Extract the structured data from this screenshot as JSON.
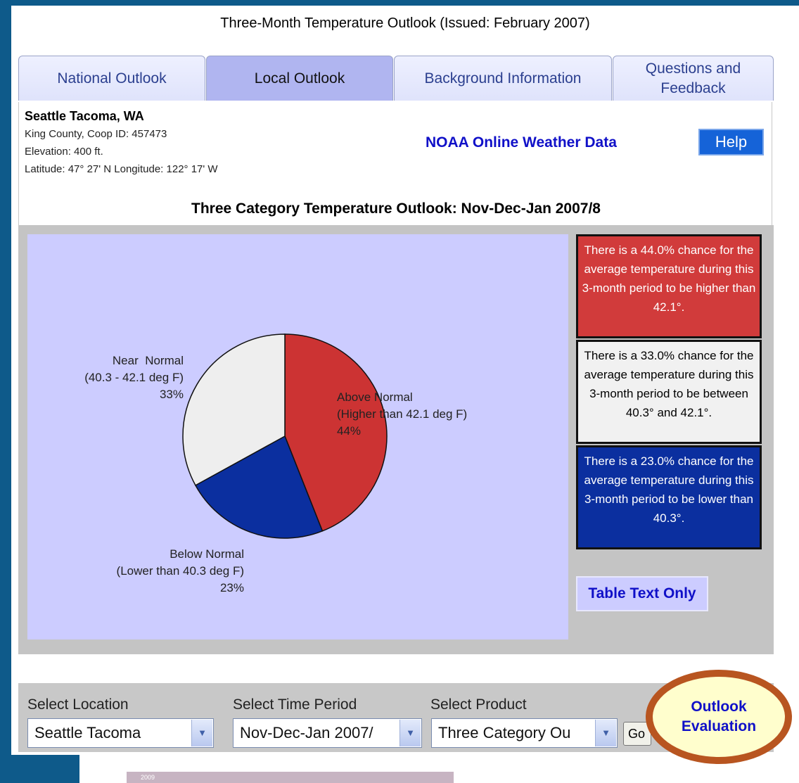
{
  "page_title": "Three-Month Temperature Outlook (Issued: February 2007)",
  "tabs": [
    {
      "label": "National Outlook",
      "active": false
    },
    {
      "label": "Local Outlook",
      "active": true
    },
    {
      "label": "Background Information",
      "active": false
    },
    {
      "label": "Questions and Feedback",
      "active": false
    }
  ],
  "location": {
    "name": "Seattle Tacoma, WA",
    "county": "King County, Coop ID: 457473",
    "elevation": "Elevation: 400 ft.",
    "latlon": "Latitude: 47° 27' N Longitude: 122° 17' W"
  },
  "noaa_link": "NOAA Online Weather Data",
  "help_label": "Help",
  "chart_title": "Three Category Temperature Outlook: Nov-Dec-Jan 2007/8",
  "chart_data": {
    "type": "pie",
    "title": "Three Category Temperature Outlook: Nov-Dec-Jan 2007/8",
    "slices": [
      {
        "label": "Above Normal",
        "detail": "(Higher than 42.1 deg F)",
        "value": 44,
        "pct_label": "44%",
        "color": "#cc3333"
      },
      {
        "label": "Below Normal",
        "detail": "(Lower than 40.3 deg F)",
        "value": 23,
        "pct_label": "23%",
        "color": "#0b2f9f"
      },
      {
        "label": "Near  Normal",
        "detail": "(40.3 - 42.1 deg F)",
        "value": 33,
        "pct_label": "33%",
        "color": "#eeeeee"
      }
    ]
  },
  "prob_boxes": {
    "above": "There is a 44.0% chance for the average temperature during this 3-month period to be higher than 42.1°.",
    "near": "There is a 33.0% chance for the average temperature during this 3-month period to be between 40.3° and 42.1°.",
    "below": "There is a 23.0% chance for the average temperature during this 3-month period to be lower than 40.3°."
  },
  "table_text_only": "Table Text Only",
  "controls": {
    "location_label": "Select Location",
    "location_value": "Seattle Tacoma",
    "period_label": "Select Time Period",
    "period_value": "Nov-Dec-Jan 2007/",
    "product_label": "Select Product",
    "product_value": "Three Category Ou",
    "go_label": "Go"
  },
  "outlook_evaluation": "Outlook Evaluation",
  "banner_text": "2009"
}
